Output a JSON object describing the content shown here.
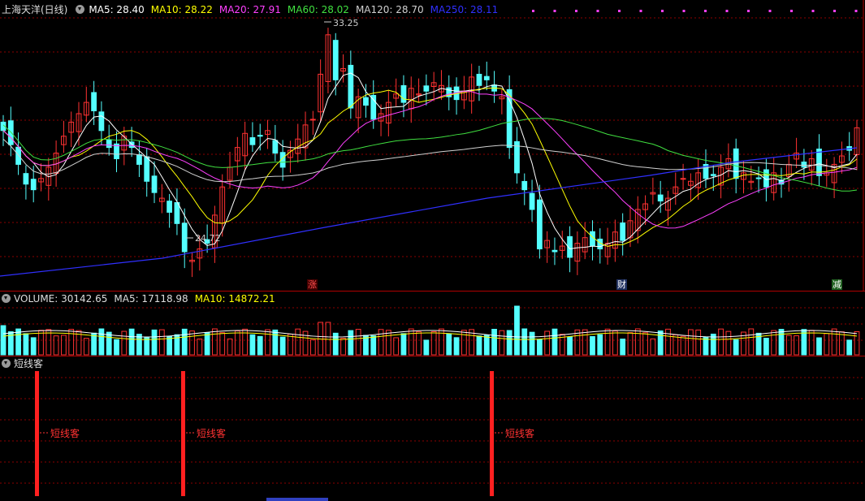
{
  "main": {
    "title": "上海天洋(日线)",
    "ma": [
      {
        "label": "MA5: 28.40",
        "color": "#ffffff"
      },
      {
        "label": "MA10: 28.22",
        "color": "#ffff00"
      },
      {
        "label": "MA20: 27.91",
        "color": "#ff40ff"
      },
      {
        "label": "MA60: 28.02",
        "color": "#40e040"
      },
      {
        "label": "MA120: 28.70",
        "color": "#d0d0d0"
      },
      {
        "label": "MA250: 28.11",
        "color": "#3030ff"
      }
    ],
    "high_label": "33.25",
    "low_label": "24.72",
    "markers": {
      "up": "涨",
      "finance": "财",
      "reduce": "减"
    }
  },
  "volume": {
    "label": "VOLUME: 30142.65",
    "ma5": "MA5: 17118.98",
    "ma10": "MA10: 14872.21"
  },
  "indicator": {
    "name": "短线客",
    "signal_label": "短线客"
  },
  "colors": {
    "up": "#ff3232",
    "down": "#54ffff",
    "grid": "#8b0000"
  }
}
